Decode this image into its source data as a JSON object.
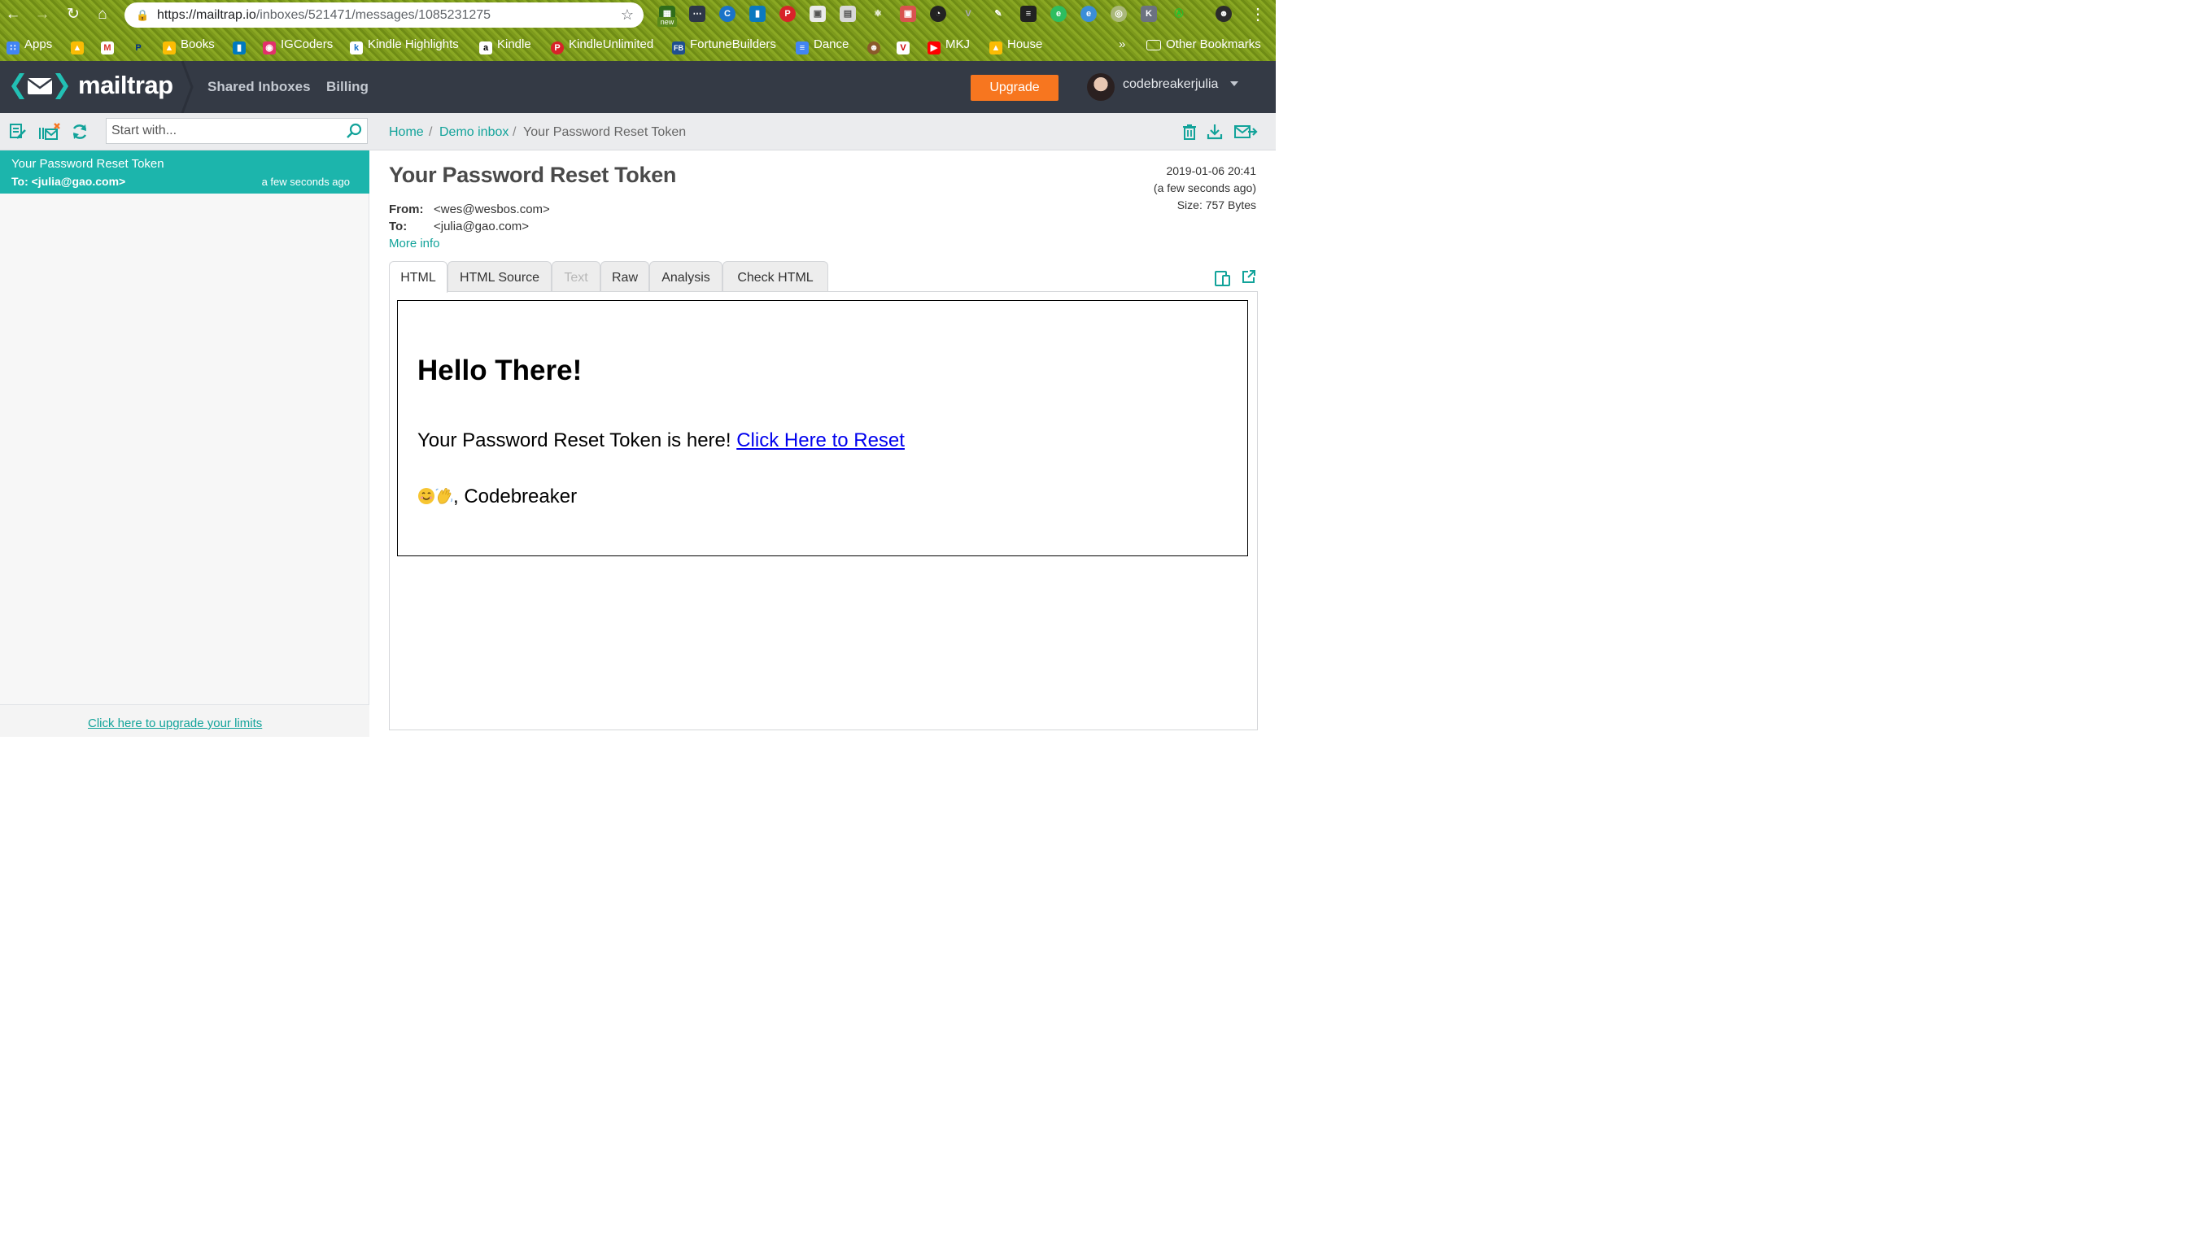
{
  "browser": {
    "url_host": "https://mailtrap.io",
    "url_path": "/inboxes/521471/messages/1085231275",
    "extension_badge": "new",
    "bookmarks": [
      {
        "label": "Apps",
        "icon": "apps-grid-icon"
      },
      {
        "label": "",
        "icon": "google-drive-icon"
      },
      {
        "label": "",
        "icon": "gmail-icon"
      },
      {
        "label": "",
        "icon": "paypal-icon"
      },
      {
        "label": "Books",
        "icon": "google-drive-icon"
      },
      {
        "label": "",
        "icon": "trello-icon"
      },
      {
        "label": "IGCoders",
        "icon": "instagram-icon"
      },
      {
        "label": "Kindle Highlights",
        "icon": "kindle-k-icon"
      },
      {
        "label": "Kindle",
        "icon": "amazon-icon"
      },
      {
        "label": "KindleUnlimited",
        "icon": "pinterest-icon"
      },
      {
        "label": "FortuneBuilders",
        "icon": "fb-icon"
      },
      {
        "label": "Dance",
        "icon": "google-docs-icon"
      },
      {
        "label": "",
        "icon": "avatar-icon"
      },
      {
        "label": "",
        "icon": "v-icon"
      },
      {
        "label": "MKJ",
        "icon": "youtube-icon"
      },
      {
        "label": "House",
        "icon": "google-drive-icon"
      }
    ],
    "overflow_label": "»",
    "other_bookmarks": "Other Bookmarks"
  },
  "header": {
    "logo": "mailtrap",
    "nav": [
      "Shared Inboxes",
      "Billing"
    ],
    "upgrade_label": "Upgrade",
    "username": "codebreakerjulia"
  },
  "sidebar": {
    "search_placeholder": "Start with...",
    "messages": [
      {
        "subject": "Your Password Reset Token",
        "to": "To: <julia@gao.com>",
        "time": "a few seconds ago"
      }
    ],
    "footer_link": "Click here to upgrade your limits"
  },
  "breadcrumb": {
    "home": "Home",
    "sep": "/",
    "inbox": "Demo inbox",
    "current": "Your Password Reset Token"
  },
  "message": {
    "title": "Your Password Reset Token",
    "date": "2019-01-06 20:41",
    "relative": "(a few seconds ago)",
    "size": "Size: 757 Bytes",
    "from_label": "From:",
    "from": "<wes@wesbos.com>",
    "to_label": "To:",
    "to": "<julia@gao.com>",
    "more_info": "More info",
    "tabs": [
      {
        "label": "HTML",
        "state": "active"
      },
      {
        "label": "HTML Source",
        "state": "normal"
      },
      {
        "label": "Text",
        "state": "disabled"
      },
      {
        "label": "Raw",
        "state": "normal"
      },
      {
        "label": "Analysis",
        "state": "normal"
      },
      {
        "label": "Check HTML",
        "state": "normal"
      }
    ]
  },
  "email": {
    "heading": "Hello There!",
    "body_text": "Your Password Reset Token is here!",
    "link_text": "Click Here to Reset",
    "signoff": ", Codebreaker"
  },
  "colors": {
    "teal": "#1cb5ac",
    "header_bg": "#343a45",
    "upgrade": "#f7761f",
    "link": "#0000ee"
  }
}
